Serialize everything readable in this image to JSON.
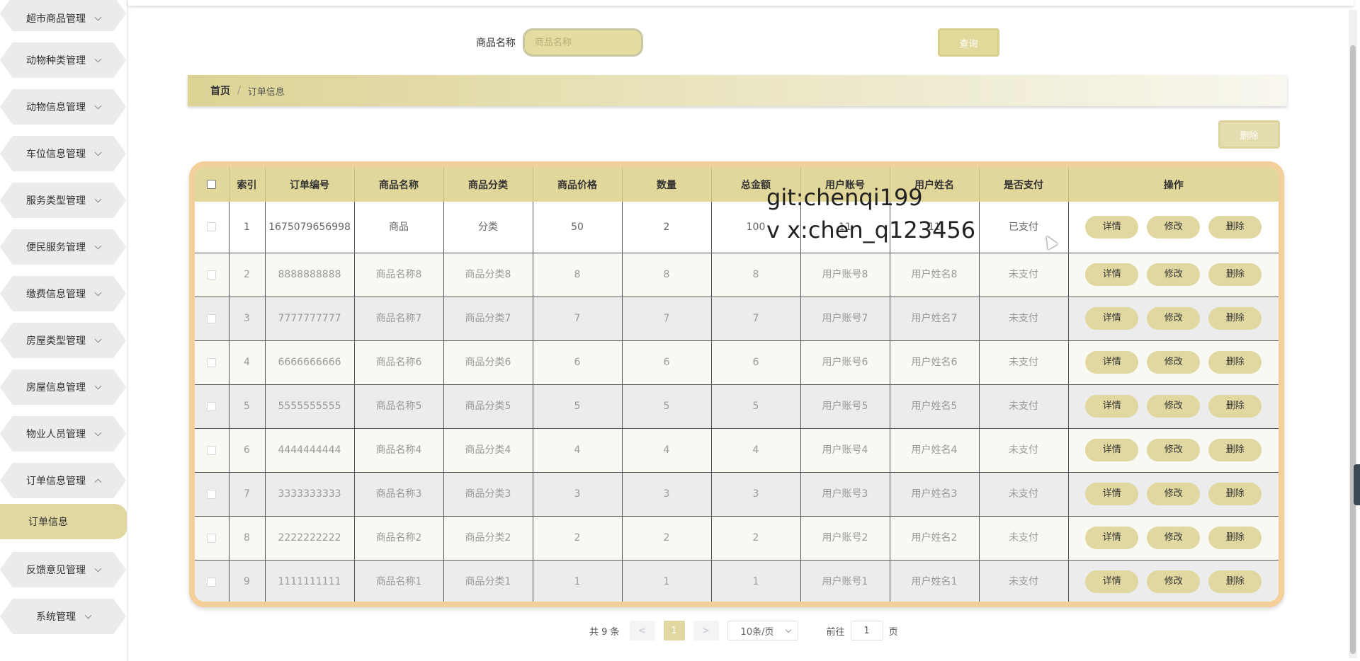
{
  "sidebar": {
    "items": [
      {
        "label": "超市商品管理",
        "expanded": false
      },
      {
        "label": "动物种类管理",
        "expanded": false
      },
      {
        "label": "动物信息管理",
        "expanded": false
      },
      {
        "label": "车位信息管理",
        "expanded": false
      },
      {
        "label": "服务类型管理",
        "expanded": false
      },
      {
        "label": "便民服务管理",
        "expanded": false
      },
      {
        "label": "缴费信息管理",
        "expanded": false
      },
      {
        "label": "房屋类型管理",
        "expanded": false
      },
      {
        "label": "房屋信息管理",
        "expanded": false
      },
      {
        "label": "物业人员管理",
        "expanded": false
      },
      {
        "label": "订单信息管理",
        "expanded": true
      },
      {
        "label": "反馈意见管理",
        "expanded": false
      },
      {
        "label": "系统管理",
        "expanded": false
      }
    ],
    "active_sub": "订单信息"
  },
  "search": {
    "label": "商品名称",
    "placeholder": "商品名称",
    "value": "",
    "query_button": "查询"
  },
  "breadcrumb": {
    "home": "首页",
    "separator": "/",
    "current": "订单信息"
  },
  "toolbar": {
    "delete_button": "删除"
  },
  "table": {
    "headers": [
      "",
      "索引",
      "订单编号",
      "商品名称",
      "商品分类",
      "商品价格",
      "数量",
      "总金额",
      "用户账号",
      "用户姓名",
      "是否支付",
      "操作"
    ],
    "rows": [
      {
        "index": "1",
        "order_no": "1675079656998",
        "goods_name": "商品",
        "goods_category": "分类",
        "price": "50",
        "qty": "2",
        "total": "100",
        "account": "11",
        "user_name": "11",
        "paid": "已支付"
      },
      {
        "index": "2",
        "order_no": "8888888888",
        "goods_name": "商品名称8",
        "goods_category": "商品分类8",
        "price": "8",
        "qty": "8",
        "total": "8",
        "account": "用户账号8",
        "user_name": "用户姓名8",
        "paid": "未支付"
      },
      {
        "index": "3",
        "order_no": "7777777777",
        "goods_name": "商品名称7",
        "goods_category": "商品分类7",
        "price": "7",
        "qty": "7",
        "total": "7",
        "account": "用户账号7",
        "user_name": "用户姓名7",
        "paid": "未支付"
      },
      {
        "index": "4",
        "order_no": "6666666666",
        "goods_name": "商品名称6",
        "goods_category": "商品分类6",
        "price": "6",
        "qty": "6",
        "total": "6",
        "account": "用户账号6",
        "user_name": "用户姓名6",
        "paid": "未支付"
      },
      {
        "index": "5",
        "order_no": "5555555555",
        "goods_name": "商品名称5",
        "goods_category": "商品分类5",
        "price": "5",
        "qty": "5",
        "total": "5",
        "account": "用户账号5",
        "user_name": "用户姓名5",
        "paid": "未支付"
      },
      {
        "index": "6",
        "order_no": "4444444444",
        "goods_name": "商品名称4",
        "goods_category": "商品分类4",
        "price": "4",
        "qty": "4",
        "total": "4",
        "account": "用户账号4",
        "user_name": "用户姓名4",
        "paid": "未支付"
      },
      {
        "index": "7",
        "order_no": "3333333333",
        "goods_name": "商品名称3",
        "goods_category": "商品分类3",
        "price": "3",
        "qty": "3",
        "total": "3",
        "account": "用户账号3",
        "user_name": "用户姓名3",
        "paid": "未支付"
      },
      {
        "index": "8",
        "order_no": "2222222222",
        "goods_name": "商品名称2",
        "goods_category": "商品分类2",
        "price": "2",
        "qty": "2",
        "total": "2",
        "account": "用户账号2",
        "user_name": "用户姓名2",
        "paid": "未支付"
      },
      {
        "index": "9",
        "order_no": "1111111111",
        "goods_name": "商品名称1",
        "goods_category": "商品分类1",
        "price": "1",
        "qty": "1",
        "total": "1",
        "account": "用户账号1",
        "user_name": "用户姓名1",
        "paid": "未支付"
      }
    ],
    "actions": {
      "detail": "详情",
      "edit": "修改",
      "delete": "删除"
    }
  },
  "watermark": {
    "line1": "git:chenqi199",
    "line2": "v x:chen_q123456"
  },
  "pagination": {
    "total_text": "共 9 条",
    "prev": "<",
    "current_page": "1",
    "next": ">",
    "page_size": "10条/页",
    "goto_prefix": "前往",
    "goto_value": "1",
    "goto_suffix": "页"
  },
  "colors": {
    "accent": "#e0d8a0",
    "header_bg": "#e2d79a",
    "table_border": "#f3cf9a",
    "menu_bg": "#ebebeb"
  }
}
